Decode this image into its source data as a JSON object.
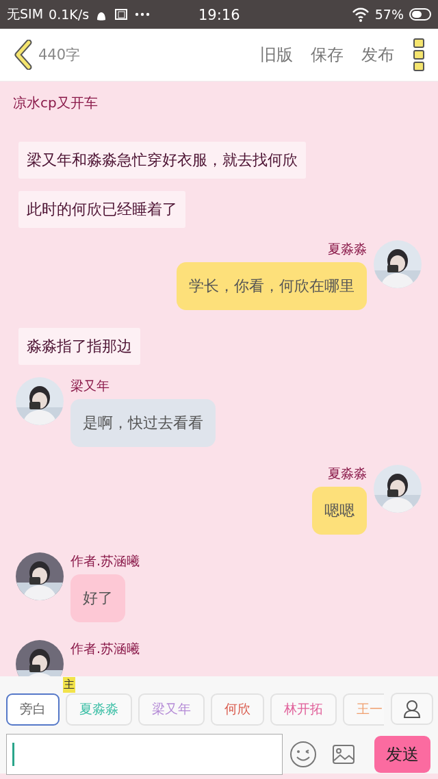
{
  "status_bar": {
    "carrier": "无SIM",
    "speed": "0.1K/s",
    "time": "19:16",
    "battery": "57%"
  },
  "header": {
    "word_count": "440字",
    "actions": [
      "旧版",
      "保存",
      "发布"
    ]
  },
  "story_title": "凉水cp又开车",
  "messages": [
    {
      "kind": "narration",
      "text": "梁又年和淼淼急忙穿好衣服，就去找何欣"
    },
    {
      "kind": "narration",
      "text": "此时的何欣已经睡着了"
    },
    {
      "kind": "outgoing",
      "speaker": "夏淼淼",
      "text": "学长，你看，何欣在哪里"
    },
    {
      "kind": "narration",
      "text": "淼淼指了指那边"
    },
    {
      "kind": "incoming",
      "speaker": "梁又年",
      "text": "是啊，快过去看看",
      "color": "#dfe4ec"
    },
    {
      "kind": "outgoing",
      "speaker": "夏淼淼",
      "text": "嗯嗯"
    },
    {
      "kind": "incoming",
      "speaker": "作者.苏涵曦",
      "text": "好了",
      "color": "#fdc8d5"
    },
    {
      "kind": "incoming",
      "speaker": "作者.苏涵曦"
    }
  ],
  "characters": [
    {
      "label": "旁白",
      "selected": true,
      "color": "#666666"
    },
    {
      "label": "夏淼淼",
      "selected": false,
      "color": "#3cbfa6",
      "badge": "主"
    },
    {
      "label": "梁又年",
      "selected": false,
      "color": "#b48ad6"
    },
    {
      "label": "何欣",
      "selected": false,
      "color": "#d9584a"
    },
    {
      "label": "林开拓",
      "selected": false,
      "color": "#e0609a"
    },
    {
      "label": "王一",
      "selected": false,
      "color": "#f0a070"
    }
  ],
  "composer": {
    "send": "发送"
  }
}
